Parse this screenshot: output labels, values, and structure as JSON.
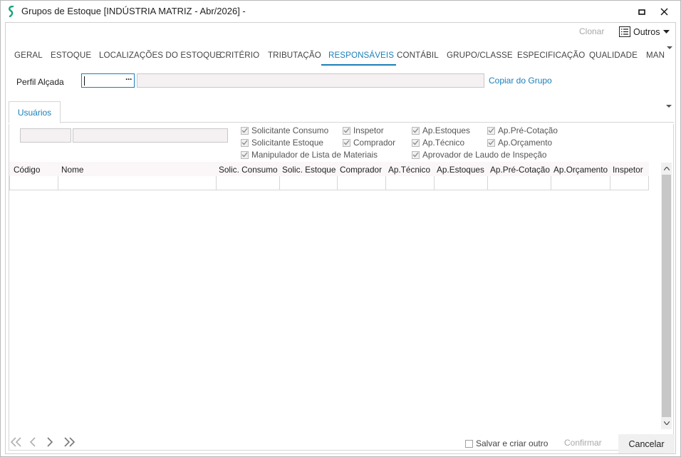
{
  "window": {
    "title": "Grupos de Estoque [INDÚSTRIA MATRIZ - Abr/2026]  -",
    "brand_color": "#1aa37a"
  },
  "toolbar": {
    "clonar_label": "Clonar",
    "outros_label": "Outros"
  },
  "tabs": [
    {
      "label": "GERAL"
    },
    {
      "label": "ESTOQUE"
    },
    {
      "label": "LOCALIZAÇÕES DO ESTOQUE"
    },
    {
      "label": "CRITÉRIO"
    },
    {
      "label": "TRIBUTAÇÃO"
    },
    {
      "label": "RESPONSÁVEIS",
      "active": true
    },
    {
      "label": "CONTÁBIL"
    },
    {
      "label": "GRUPO/CLASSE"
    },
    {
      "label": "ESPECIFICAÇÃO"
    },
    {
      "label": "QUALIDADE"
    },
    {
      "label": "MAN"
    }
  ],
  "perfil": {
    "label": "Perfil Alçada",
    "lookup_button": "···",
    "copy_link": "Copiar do Grupo"
  },
  "subtabs": {
    "usuarios": "Usuários"
  },
  "filters": {
    "solicitante_consumo": "Solicitante Consumo",
    "solicitante_estoque": "Solicitante Estoque",
    "manipulador": "Manipulador de Lista de Materiais",
    "inspetor": "Inspetor",
    "comprador": "Comprador",
    "ap_estoques": "Ap.Estoques",
    "ap_tecnico": "Ap.Técnico",
    "aprovador_laudo": "Aprovador de Laudo de Inspeção",
    "ap_pre_cotacao": "Ap.Pré-Cotação",
    "ap_orcamento": "Ap.Orçamento"
  },
  "grid": {
    "columns": [
      "Código",
      "Nome",
      "Solic. Consumo",
      "Solic. Estoque",
      "Comprador",
      "Ap.Técnico",
      "Ap.Estoques",
      "Ap.Pré-Cotação",
      "Ap.Orçamento",
      "Inspetor"
    ]
  },
  "footer": {
    "save_and_create": "Salvar e criar outro",
    "confirm": "Confirmar",
    "cancel": "Cancelar"
  }
}
